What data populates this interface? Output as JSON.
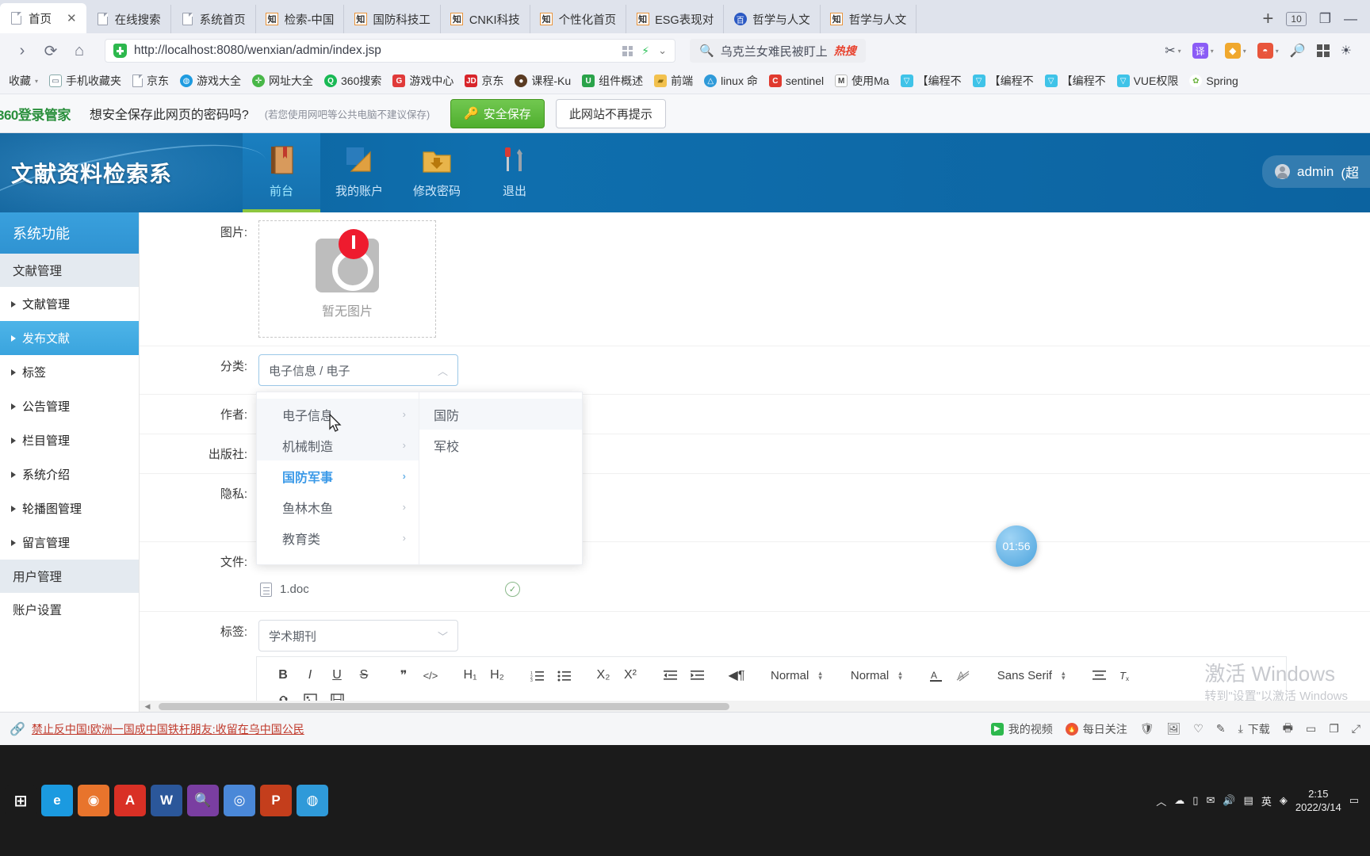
{
  "browser": {
    "tabs": [
      {
        "label": "首页",
        "icon": "doc-icon",
        "active": true,
        "closable": true
      },
      {
        "label": "在线搜索",
        "icon": "doc-icon",
        "active": false
      },
      {
        "label": "系统首页",
        "icon": "doc-icon",
        "active": false
      },
      {
        "label": "检索-中国",
        "icon": "zhiwang-icon",
        "active": false
      },
      {
        "label": "国防科技工",
        "icon": "zhiwang-icon",
        "active": false
      },
      {
        "label": "CNKI科技",
        "icon": "zhiwang-icon",
        "active": false
      },
      {
        "label": "个性化首页",
        "icon": "zhiwang-icon",
        "active": false
      },
      {
        "label": "ESG表现对",
        "icon": "zhiwang-icon",
        "active": false
      },
      {
        "label": "哲学与人文",
        "icon": "baidu-icon",
        "active": false
      },
      {
        "label": "哲学与人文",
        "icon": "zhiwang-icon",
        "active": false
      }
    ],
    "new_tab_label": "+",
    "tab_count": "10",
    "window_controls": {
      "restore": "❐",
      "minimize": "—"
    },
    "nav": {
      "forward": "›",
      "reload": "⟳",
      "home": "⌂"
    },
    "address": {
      "url": "http://localhost:8080/wenxian/admin/index.jsp",
      "security_icon": "shield-icon",
      "qr_icon": "qrcode-icon",
      "bolt_icon": "bolt-icon",
      "chevron_icon": "chevron-down-icon"
    },
    "search": {
      "query": "乌克兰女难民被盯上",
      "badge": "热搜",
      "icon": "search-icon"
    },
    "toolbar_icons": [
      "scissors-icon",
      "translate-icon",
      "shield-guard-icon",
      "gamepad-icon",
      "magnifier-icon",
      "apps-grid-icon",
      "brightness-icon"
    ],
    "bookmarks": {
      "root_label": "收藏",
      "items": [
        {
          "label": "手机收藏夹",
          "icon": "phone-icon",
          "color": "#ffffff"
        },
        {
          "label": "京东",
          "icon": "doc-icon",
          "color": "#ffffff"
        },
        {
          "label": "游戏大全",
          "icon": "globe-icon",
          "color": "#1e9be0"
        },
        {
          "label": "网址大全",
          "icon": "plus-icon",
          "color": "#49b749"
        },
        {
          "label": "360搜索",
          "icon": "circle-icon",
          "color": "#19b955"
        },
        {
          "label": "游戏中心",
          "icon": "g-icon",
          "color": "#e03a3a"
        },
        {
          "label": "京东",
          "icon": "jd-icon",
          "color": "#d8252b"
        },
        {
          "label": "课程-Ku",
          "icon": "user-icon",
          "color": "#5a3b22"
        },
        {
          "label": "组件概述",
          "icon": "u-icon",
          "color": "#2aa34a"
        },
        {
          "label": "前端",
          "icon": "folder-icon",
          "color": "#f2c14e"
        },
        {
          "label": "linux 命",
          "icon": "linux-icon",
          "color": "#2f9ad9"
        },
        {
          "label": "sentinel",
          "icon": "c-icon",
          "color": "#e03a2f"
        },
        {
          "label": "使用Ma",
          "icon": "maven-icon",
          "color": "#4a4a4a"
        },
        {
          "label": "【编程不",
          "icon": "bili-icon",
          "color": "#3fc3e8"
        },
        {
          "label": "【编程不",
          "icon": "bili-icon",
          "color": "#3fc3e8"
        },
        {
          "label": "【编程不",
          "icon": "bili-icon",
          "color": "#3fc3e8"
        },
        {
          "label": "VUE权限",
          "icon": "bili-icon",
          "color": "#3fc3e8"
        },
        {
          "label": "Spring",
          "icon": "spring-icon",
          "color": "#6db33f"
        }
      ]
    },
    "password_bar": {
      "logo": "360登录管家",
      "question": "想安全保存此网页的密码吗?",
      "hint": "(若您使用网吧等公共电脑不建议保存)",
      "save_label": "安全保存",
      "save_icon": "key-icon",
      "never_label": "此网站不再提示"
    }
  },
  "app": {
    "title": "文献资料检索系",
    "nav": [
      {
        "label": "前台",
        "icon": "book-icon",
        "active": true
      },
      {
        "label": "我的账户",
        "icon": "ruler-icon",
        "active": false
      },
      {
        "label": "修改密码",
        "icon": "folder-download-icon",
        "active": false
      },
      {
        "label": "退出",
        "icon": "tools-icon",
        "active": false
      }
    ],
    "user": {
      "name": "admin",
      "role": "(超",
      "avatar_icon": "avatar-icon"
    },
    "sidebar": {
      "header": "系统功能",
      "groups": [
        {
          "title": "文献管理",
          "items": [
            {
              "label": "文献管理",
              "active": false
            },
            {
              "label": "发布文献",
              "active": true
            },
            {
              "label": "标签",
              "active": false
            },
            {
              "label": "公告管理",
              "active": false
            },
            {
              "label": "栏目管理",
              "active": false
            },
            {
              "label": "系统介绍",
              "active": false
            },
            {
              "label": "轮播图管理",
              "active": false
            },
            {
              "label": "留言管理",
              "active": false
            }
          ]
        },
        {
          "title": "用户管理",
          "items": []
        },
        {
          "title": "账户设置",
          "items": []
        }
      ]
    },
    "form": {
      "image": {
        "label": "图片:",
        "placeholder": "暂无图片"
      },
      "category": {
        "label": "分类:",
        "value": "电子信息 / 电子",
        "chevron": "chevron-up-icon"
      },
      "author": {
        "label": "作者:"
      },
      "publisher": {
        "label": "出版社:"
      },
      "privacy": {
        "label": "隐私:"
      },
      "file": {
        "label": "文件:",
        "filename": "1.doc",
        "status_icon": "check-circle-icon"
      },
      "tag": {
        "label": "标签:",
        "value": "学术期刊",
        "chevron": "chevron-down-icon"
      }
    },
    "cascader": {
      "col1": [
        {
          "label": "电子信息",
          "state": "hover"
        },
        {
          "label": "机械制造",
          "state": "hover"
        },
        {
          "label": "国防军事",
          "state": "selected"
        },
        {
          "label": "鱼林木鱼",
          "state": "normal"
        },
        {
          "label": "教育类",
          "state": "normal"
        }
      ],
      "col2": [
        {
          "label": "国防",
          "state": "hover"
        },
        {
          "label": "军校",
          "state": "normal"
        }
      ],
      "arrow_icon": "chevron-right-icon"
    },
    "editor_toolbar": {
      "row1": [
        "B",
        "I",
        "U",
        "S",
        "❞",
        "</>",
        "H₁",
        "H₂",
        "list-ordered",
        "list-bullet",
        "X₂",
        "X²",
        "indent-out",
        "indent-in",
        "direction"
      ],
      "selects": [
        {
          "value": "Normal"
        },
        {
          "value": "Normal"
        },
        {
          "value": "Sans Serif"
        }
      ],
      "icons_after": [
        "font-color-icon",
        "highlight-icon",
        "align-icon",
        "clear-format-icon"
      ],
      "row2": [
        "link-icon",
        "image-icon",
        "video-icon"
      ]
    },
    "timer_bubble": "01:56",
    "watermark": {
      "line1": "激活 Windows",
      "line2": "转到\"设置\"以激活 Windows"
    }
  },
  "statusbar": {
    "news": "禁止反中国!欧洲一国成中国铁杆朋友:收留在乌中国公民",
    "news_icon": "link-icon",
    "items": [
      {
        "label": "我的视频",
        "icon": "video-icon"
      },
      {
        "label": "每日关注",
        "icon": "flame-icon"
      }
    ],
    "right_icons": [
      "shield-icon",
      "image-icon",
      "heart-icon",
      "pen-icon",
      "download-icon",
      "print-icon",
      "window-icon",
      "tab-icon",
      "expand-icon"
    ],
    "download_label": "下载"
  },
  "taskbar": {
    "apps": [
      {
        "name": "start-button",
        "glyph": "⊞",
        "color": "#1b1b1b"
      },
      {
        "name": "edge-icon",
        "glyph": "e",
        "color": "#1b9ae0"
      },
      {
        "name": "firefox-icon",
        "glyph": "🦊",
        "color": "#e8742c"
      },
      {
        "name": "pdf-icon",
        "glyph": "A",
        "color": "#d93025"
      },
      {
        "name": "word-icon",
        "glyph": "W",
        "color": "#2b579a"
      },
      {
        "name": "search-icon",
        "glyph": "🔍",
        "color": "#7a3ea1"
      },
      {
        "name": "chrome-icon",
        "glyph": "◎",
        "color": "#4a88d8"
      },
      {
        "name": "ppt-icon",
        "glyph": "P",
        "color": "#c43e1c"
      },
      {
        "name": "browser360-icon",
        "glyph": "◍",
        "color": "#2f9ad9"
      }
    ],
    "tray": [
      "^",
      "battery-icon",
      "network-icon",
      "volume-icon",
      "ime-icon",
      "cloud-icon",
      "notify-icon"
    ],
    "ime_label": "英",
    "clock": {
      "time": "2:15",
      "date": "2022/3/14"
    }
  }
}
